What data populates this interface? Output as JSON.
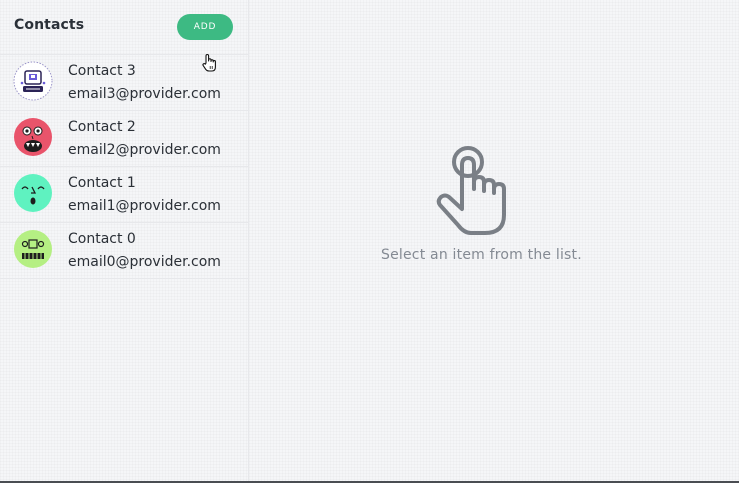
{
  "sidebar": {
    "title": "Contacts",
    "add_label": "ADD",
    "contacts": [
      {
        "name": "Contact 3",
        "email": "email3@provider.com",
        "avatar_icon": "robot-face-avatar-icon",
        "avatar_color": "#ffffff"
      },
      {
        "name": "Contact 2",
        "email": "email2@provider.com",
        "avatar_icon": "monster-face-avatar-icon",
        "avatar_color": "#e9546b"
      },
      {
        "name": "Contact 1",
        "email": "email1@provider.com",
        "avatar_icon": "surprised-face-avatar-icon",
        "avatar_color": "#5ff2c0"
      },
      {
        "name": "Contact 0",
        "email": "email0@provider.com",
        "avatar_icon": "zombie-face-avatar-icon",
        "avatar_color": "#b5ef83"
      }
    ]
  },
  "main": {
    "empty_icon": "pointing-hand-icon",
    "empty_message": "Select an item from the list."
  },
  "colors": {
    "accent": "#3dba83",
    "muted_text": "#848a93",
    "divider": "#e7e8eb"
  }
}
